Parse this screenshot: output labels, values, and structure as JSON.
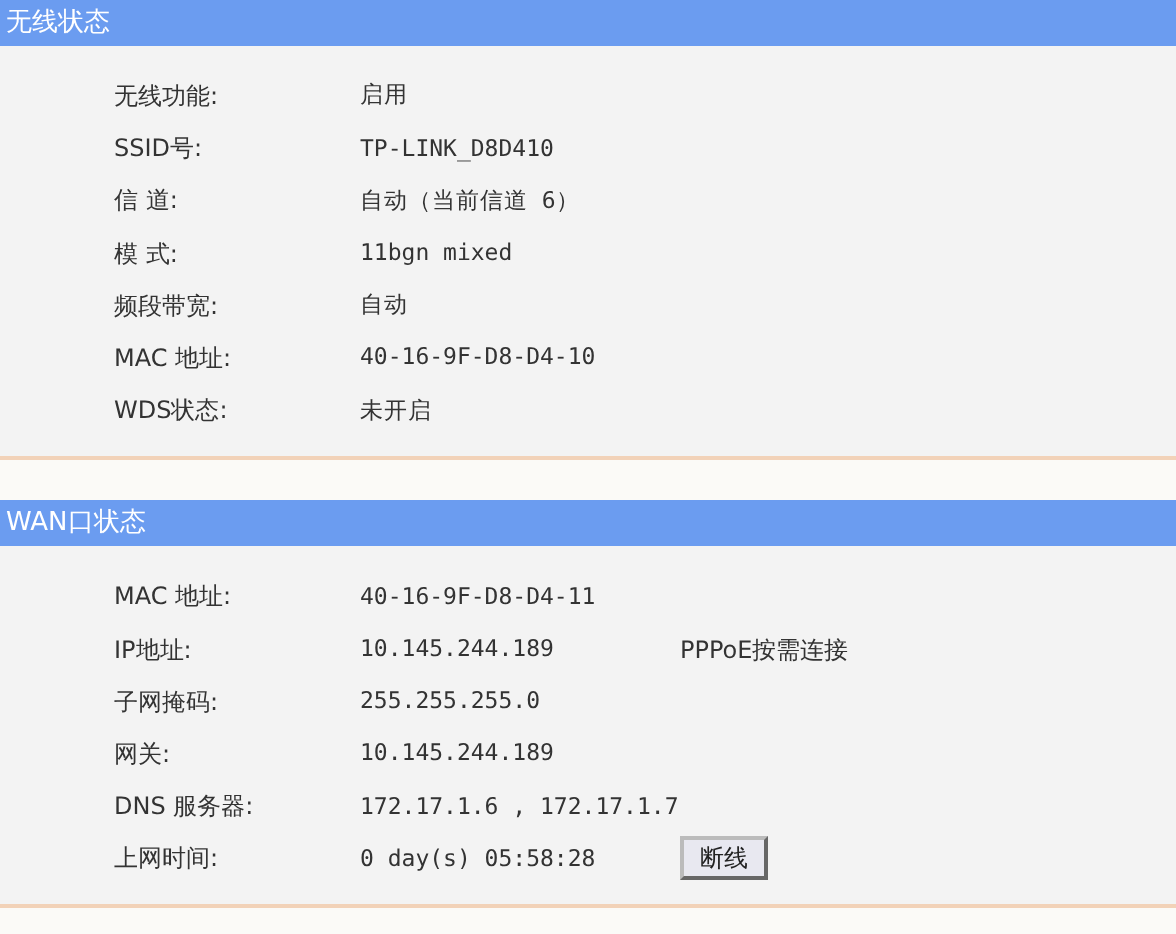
{
  "sections": [
    {
      "title": "无线状态",
      "rows": [
        {
          "label": "无线功能:",
          "value": "启用"
        },
        {
          "label": "SSID号:",
          "value": "TP-LINK_D8D410"
        },
        {
          "label": "信 道:",
          "value": "自动（当前信道 6）"
        },
        {
          "label": "模 式:",
          "value": "11bgn mixed"
        },
        {
          "label": "频段带宽:",
          "value": "自动"
        },
        {
          "label": "MAC 地址:",
          "value": "40-16-9F-D8-D4-10"
        },
        {
          "label": "WDS状态:",
          "value": "未开启"
        }
      ]
    },
    {
      "title": "WAN口状态",
      "rows": [
        {
          "label": "MAC 地址:",
          "value": "40-16-9F-D8-D4-11"
        },
        {
          "label": "IP地址:",
          "value": "10.145.244.189",
          "extra": {
            "kind": "text",
            "text": "PPPoE按需连接"
          }
        },
        {
          "label": "子网掩码:",
          "value": "255.255.255.0"
        },
        {
          "label": "网关:",
          "value": "10.145.244.189"
        },
        {
          "label": "DNS 服务器:",
          "value": "172.17.1.6 , 172.17.1.7"
        },
        {
          "label": "上网时间:",
          "value": "0 day(s) 05:58:28",
          "extra": {
            "kind": "button",
            "text": "断线"
          }
        }
      ]
    }
  ]
}
